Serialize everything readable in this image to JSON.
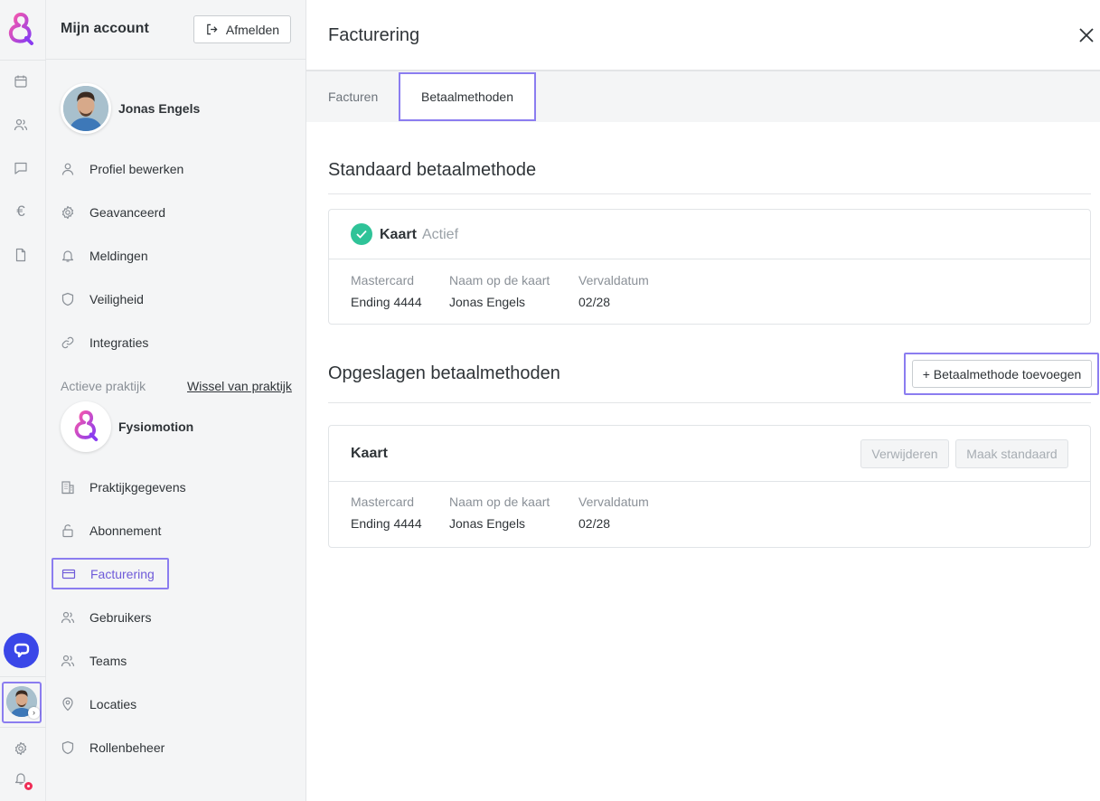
{
  "rail": {
    "icons": [
      "calendar-icon",
      "users-icon",
      "chat-icon",
      "euro-icon",
      "document-icon",
      "settings-icon",
      "bell-icon"
    ],
    "euro_symbol": "€",
    "chevron": "›"
  },
  "sidebar": {
    "title": "Mijn account",
    "logout_label": "Afmelden",
    "user_name": "Jonas Engels",
    "account_items": [
      {
        "label": "Profiel bewerken",
        "icon": "user-icon"
      },
      {
        "label": "Geavanceerd",
        "icon": "gear-icon"
      },
      {
        "label": "Meldingen",
        "icon": "bell-icon"
      },
      {
        "label": "Veiligheid",
        "icon": "shield-icon"
      },
      {
        "label": "Integraties",
        "icon": "link-icon"
      }
    ],
    "practice_label": "Actieve praktijk",
    "practice_switch": "Wissel van praktijk",
    "practice_name": "Fysiomotion",
    "practice_items": [
      {
        "label": "Praktijkgegevens",
        "icon": "building-icon"
      },
      {
        "label": "Abonnement",
        "icon": "lock-icon"
      },
      {
        "label": "Facturering",
        "icon": "credit-card-icon",
        "active": true
      },
      {
        "label": "Gebruikers",
        "icon": "users-icon"
      },
      {
        "label": "Teams",
        "icon": "team-icon"
      },
      {
        "label": "Locaties",
        "icon": "location-icon"
      },
      {
        "label": "Rollenbeheer",
        "icon": "shield-icon"
      }
    ]
  },
  "main": {
    "title": "Facturering",
    "tabs": [
      {
        "label": "Facturen",
        "active": false
      },
      {
        "label": "Betaalmethoden",
        "active": true
      }
    ],
    "default_section": {
      "title": "Standaard betaalmethode",
      "card": {
        "type": "Kaart",
        "status": "Actief",
        "brand_label": "Mastercard",
        "brand_value": "Ending 4444",
        "name_label": "Naam op de kaart",
        "name_value": "Jonas Engels",
        "expiry_label": "Vervaldatum",
        "expiry_value": "02/28"
      }
    },
    "saved_section": {
      "title": "Opgeslagen betaalmethoden",
      "add_button": "+ Betaalmethode toevoegen",
      "card": {
        "type": "Kaart",
        "remove_button": "Verwijderen",
        "make_default_button": "Maak standaard",
        "brand_label": "Mastercard",
        "brand_value": "Ending 4444",
        "name_label": "Naam op de kaart",
        "name_value": "Jonas Engels",
        "expiry_label": "Vervaldatum",
        "expiry_value": "02/28"
      }
    }
  },
  "colors": {
    "accent": "#8b7df0",
    "active_text": "#6f5bd9",
    "success": "#2fc398",
    "chat": "#3a47e8",
    "notification": "#ef2d56"
  }
}
